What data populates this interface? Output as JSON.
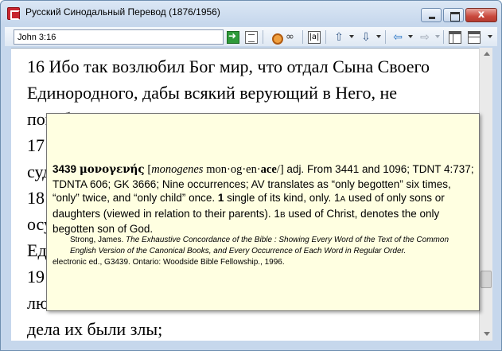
{
  "window": {
    "title": "Русский Синодальный Перевод (1876/1956)",
    "close_glyph": "x"
  },
  "toolbar": {
    "reference_value": "John 3:16",
    "parallel_glyph": "|a|"
  },
  "content": {
    "lines": [
      "16 Ибо так возлюбил Бог мир, что отдал Сына Своего",
      "Единородного, дабы всякий верующий в Него, не",
      "погиб",
      "17",
      "суд",
      "18",
      "осу",
      "Ед",
      "19",
      "лю",
      "дела их были злы;"
    ]
  },
  "popup": {
    "number": "3439",
    "greek": "μονογενής",
    "bracket_open": "[",
    "transliteration": "monogenes",
    "pron_a": "mon·og·en·",
    "pron_b": "ace",
    "bracket_close": "/]",
    "pos_etym": "adj. From 3441 and 1096; TDNT 4:737; TDNTA 606; GK 3666; Nine occurrences; AV translates as “only begotten” six times, “only” twice, and “only child” once.",
    "sense1_num": "1",
    "sense1_text": "single of its kind, only.",
    "sense1a_num": "1",
    "sense1a_letter": "A",
    "sense1a_text": "used of only sons or daughters (viewed in relation to their parents).",
    "sense1b_num": "1",
    "sense1b_letter": "B",
    "sense1b_text": "used of Christ, denotes the only begotten son of God.",
    "citation_author": "Strong, James.",
    "citation_title": "The Exhaustive Concordance of the Bible : Showing Every Word of the Text of the Common English Version of the Canonical Books, and Every Occurrence of Each Word in Regular Order.",
    "citation_edition": "electronic ed., G3439. Ontario: Woodside Bible Fellowship., 1996."
  },
  "colors": {
    "popup_bg": "#ffffe1",
    "window_frame": "#c6d7ec",
    "close_button": "#c9483c"
  }
}
